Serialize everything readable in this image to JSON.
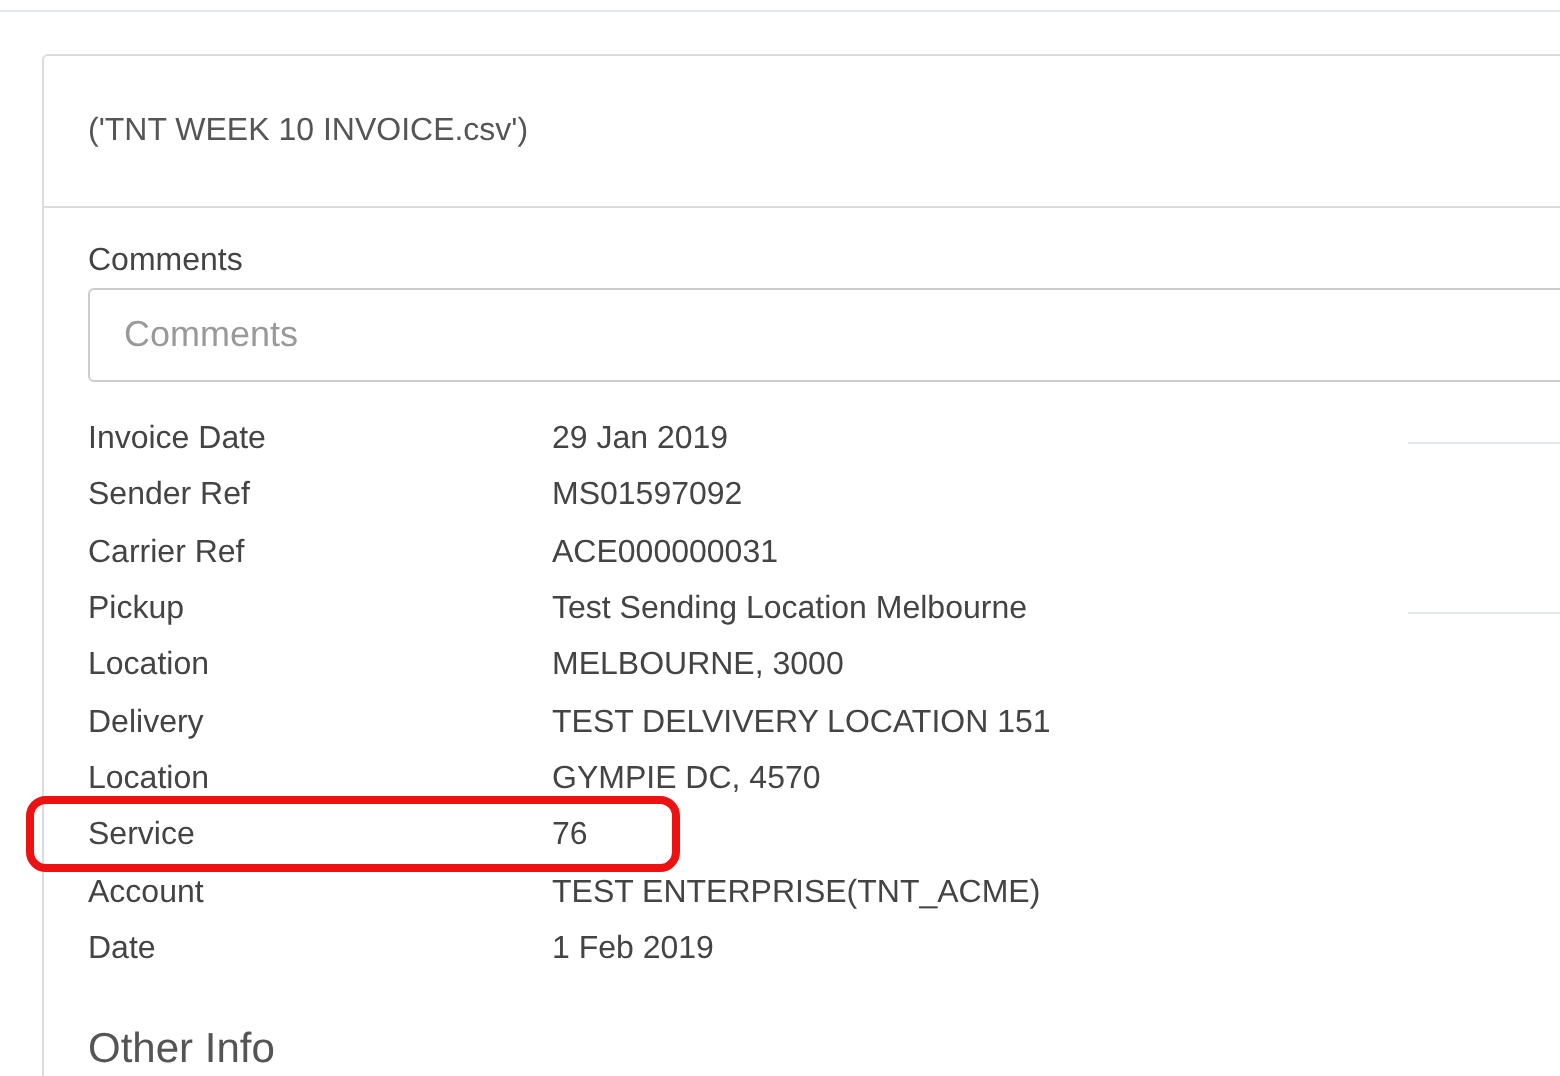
{
  "card": {
    "title": "('TNT WEEK 10 INVOICE.csv')"
  },
  "comments": {
    "label": "Comments",
    "placeholder": "Comments"
  },
  "details": [
    {
      "label": "Invoice Date",
      "value": "29 Jan 2019",
      "highlighted": false
    },
    {
      "label": "Sender Ref",
      "value": "MS01597092",
      "highlighted": false
    },
    {
      "label": "Carrier Ref",
      "value": "ACE000000031",
      "highlighted": false
    },
    {
      "label": "Pickup",
      "value": "Test Sending Location Melbourne",
      "highlighted": false
    },
    {
      "label": "Location",
      "value": "MELBOURNE, 3000",
      "highlighted": false
    },
    {
      "label": "Delivery",
      "value": "TEST DELVIVERY LOCATION 151",
      "highlighted": false
    },
    {
      "label": "Location",
      "value": "GYMPIE DC, 4570",
      "highlighted": false
    },
    {
      "label": "Service",
      "value": "76",
      "highlighted": true
    },
    {
      "label": "Account",
      "value": "TEST ENTERPRISE(TNT_ACME)",
      "highlighted": false
    },
    {
      "label": "Date",
      "value": "1 Feb 2019",
      "highlighted": false
    }
  ],
  "other_info": {
    "heading": "Other Info"
  }
}
